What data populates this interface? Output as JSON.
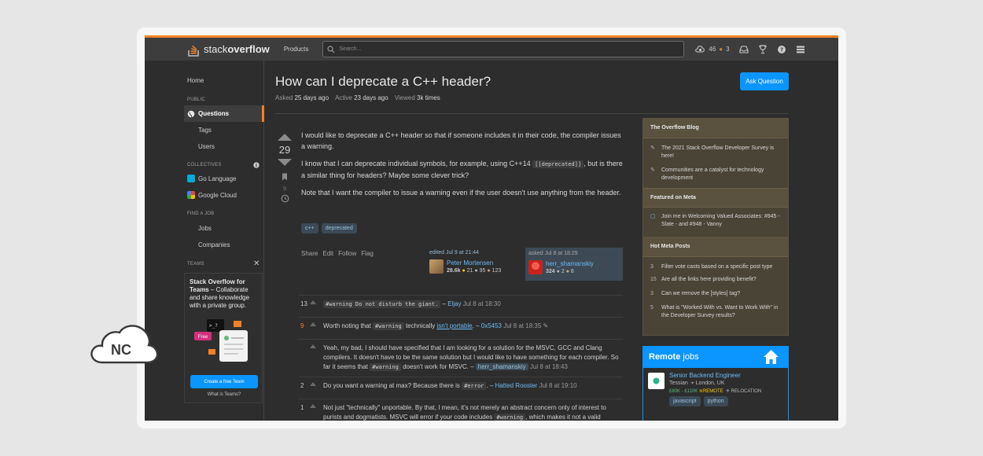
{
  "topbar": {
    "logo_regular": "stack",
    "logo_bold": "overflow",
    "products": "Products",
    "search_placeholder": "Search...",
    "reputation": "46",
    "bronze_badges": "3"
  },
  "sidebar": {
    "home": "Home",
    "public_label": "PUBLIC",
    "questions": "Questions",
    "tags": "Tags",
    "users": "Users",
    "collectives_label": "COLLECTIVES",
    "collective_go": "Go Language",
    "collective_cloud": "Google Cloud",
    "find_job_label": "FIND A JOB",
    "jobs": "Jobs",
    "companies": "Companies",
    "teams_label": "TEAMS",
    "teams_title_bold": "Stack Overflow for Teams",
    "teams_title_rest": " – Collaborate and share knowledge with a private group.",
    "teams_free": "Free",
    "create_team": "Create a free Team",
    "why_teams": "What is Teams?"
  },
  "question": {
    "title": "How can I deprecate a C++ header?",
    "asked_label": "Asked",
    "asked_value": "25 days ago",
    "active_label": "Active",
    "active_value": "23 days ago",
    "viewed_label": "Viewed",
    "viewed_value": "3k times",
    "ask_button": "Ask Question",
    "votes": "29",
    "bookmarks": "9",
    "p1": "I would like to deprecate a C++ header so that if someone includes it in their code, the compiler issues a warning.",
    "p2_a": "I know that I can deprecate individual symbols, for example, using C++14 ",
    "p2_code": "[[deprecated]]",
    "p2_b": ", but is there a similar thing for headers? Maybe some clever trick?",
    "p3": "Note that I want the compiler to issue a warning even if the user doesn't use anything from the header.",
    "tags": [
      "c++",
      "deprecated"
    ],
    "menu": [
      "Share",
      "Edit",
      "Follow",
      "Flag"
    ],
    "edited_label": "edited Jul 9 at 21:44",
    "editor_name": "Peter Mortensen",
    "editor_rep": "28.6k",
    "editor_gold": "21",
    "editor_silver": "95",
    "editor_bronze": "123",
    "asked_card_label": "asked Jul 8 at 18:29",
    "owner_name": "herr_shamanskiy",
    "owner_rep": "324",
    "owner_silver": "2",
    "owner_bronze": "8"
  },
  "comments": [
    {
      "score": "13",
      "pre": "",
      "code": "#warning Do not disturb the giant.",
      "mid": "",
      "link": "",
      "post": " – ",
      "user": "Eljay",
      "date": "Jul 8 at 18:30"
    },
    {
      "score": "9",
      "pre": "Worth noting that ",
      "code": "#warning",
      "mid": " technically ",
      "link": "isn't portable",
      "post": ". – ",
      "user": "0x5453",
      "date": "Jul 8 at 18:35"
    },
    {
      "score": "",
      "pre": "Yeah, my bad, I should have specified that I am looking for a solution for the MSVC, GCC and Clang compilers. It doesn't have to be the same solution but I would like to have something for each compiler. So far it seems that ",
      "code": "#warning",
      "mid": " doesn't work for MSVC. – ",
      "link": "",
      "post": "",
      "user": "herr_shamanskiy",
      "date": "Jul 8 at 18:43"
    },
    {
      "score": "2",
      "pre": "Do you want a warning at max? Because there is ",
      "code": "#error",
      "mid": "",
      "link": "",
      "post": ". – ",
      "user": "Hatted Rooster",
      "date": "Jul 8 at 19:10"
    },
    {
      "score": "1",
      "pre": "Not just \"technically\" unportable. By that, I mean, it's not merely an abstract concern only of interest to purists and dogmatists. MSVC will error if your code includes ",
      "code": "#warning",
      "mid": ", which makes it not a valid",
      "link": "",
      "post": "",
      "user": "",
      "date": ""
    }
  ],
  "blog": {
    "overflow_blog": "The Overflow Blog",
    "blog_items": [
      "The 2021 Stack Overflow Developer Survey is here!",
      "Communities are a catalyst for technology development"
    ],
    "featured_meta": "Featured on Meta",
    "meta_item": "Join me in Welcoming Valued Associates: #945 - Slate - and #948 - Vanny",
    "hot_meta": "Hot Meta Posts",
    "hot_items": [
      {
        "n": "3",
        "t": "Filter vote casts based on a specific post type"
      },
      {
        "n": "15",
        "t": "Are all the links here providing benefit?"
      },
      {
        "n": "3",
        "t": "Can we remove the [styles] tag?"
      },
      {
        "n": "5",
        "t": "What is \"Worked With vs. Want to Work With\" in the Developer Survey results?"
      }
    ]
  },
  "jobs": {
    "remote": "Remote",
    "jobs_word": " jobs",
    "title": "Senior Backend Engineer",
    "company": "Tessian",
    "location": "London, UK",
    "salary": "£80K - £110K",
    "remote_tag": "REMOTE",
    "relocation": "RELOCATION",
    "tags": [
      "javascript",
      "python"
    ]
  },
  "overlay": {
    "nc_text": "NC"
  },
  "colors": {
    "accent": "#f48024",
    "link": "#6cbbf7",
    "button": "#0a95ff"
  }
}
